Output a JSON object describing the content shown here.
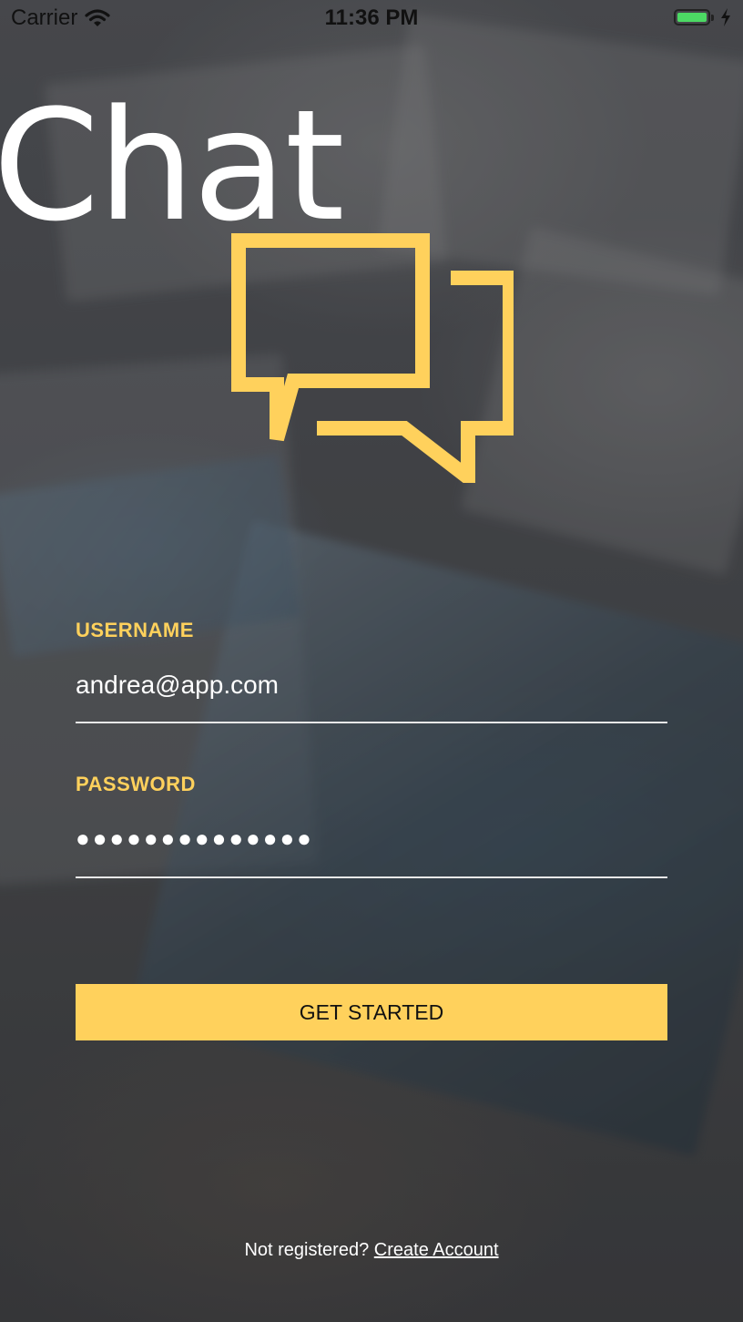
{
  "status_bar": {
    "carrier": "Carrier",
    "time": "11:36 PM"
  },
  "app": {
    "title": "Chat",
    "brand_color": "#ffd15c"
  },
  "form": {
    "username": {
      "label": "USERNAME",
      "value": "andrea@app.com"
    },
    "password": {
      "label": "PASSWORD",
      "masked_value": "●●●●●●●●●●●●●●"
    },
    "submit_label": "GET STARTED"
  },
  "footer": {
    "prompt": "Not registered?",
    "link_label": "Create Account"
  },
  "icons": {
    "wifi": "wifi-icon",
    "battery": "battery-icon",
    "charging": "charging-bolt-icon",
    "logo": "chat-bubbles-icon"
  }
}
